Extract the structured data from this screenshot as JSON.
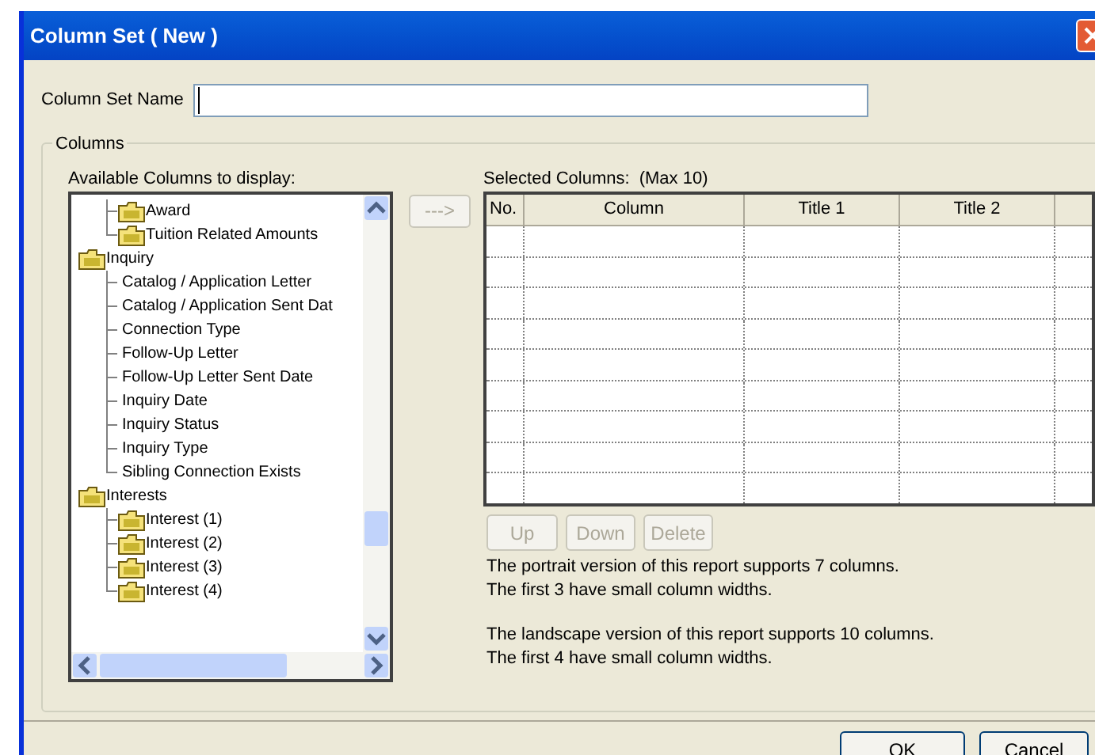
{
  "window": {
    "title": "Column Set ( New )"
  },
  "name_field": {
    "label": "Column Set Name"
  },
  "group": {
    "label": "Columns"
  },
  "available": {
    "label": "Available Columns to display:",
    "items": [
      {
        "children": [
          {
            "kind": "folder",
            "label": "Award"
          },
          {
            "kind": "folder",
            "label": "Tuition Related Amounts"
          }
        ]
      },
      {
        "kind": "folder",
        "label": "Inquiry",
        "children": [
          {
            "kind": "leaf",
            "label": "Catalog / Application Letter"
          },
          {
            "kind": "leaf",
            "label": "Catalog / Application Sent Dat"
          },
          {
            "kind": "leaf",
            "label": "Connection Type"
          },
          {
            "kind": "leaf",
            "label": "Follow-Up Letter"
          },
          {
            "kind": "leaf",
            "label": "Follow-Up Letter Sent Date"
          },
          {
            "kind": "leaf",
            "label": "Inquiry Date"
          },
          {
            "kind": "leaf",
            "label": "Inquiry Status"
          },
          {
            "kind": "leaf",
            "label": "Inquiry Type"
          },
          {
            "kind": "leaf",
            "label": "Sibling Connection Exists"
          }
        ]
      },
      {
        "kind": "folder",
        "label": "Interests",
        "children": [
          {
            "kind": "folder",
            "label": "Interest (1)"
          },
          {
            "kind": "folder",
            "label": "Interest (2)"
          },
          {
            "kind": "folder",
            "label": "Interest (3)"
          },
          {
            "kind": "folder",
            "label": "Interest (4)"
          }
        ]
      }
    ]
  },
  "add_button": {
    "label": "--->",
    "disabled": true
  },
  "selected": {
    "label": "Selected Columns:",
    "max": "(Max 10)",
    "columns": [
      "No.",
      "Column",
      "Title 1",
      "Title 2"
    ]
  },
  "row_buttons": [
    {
      "label": "Up",
      "disabled": true
    },
    {
      "label": "Down",
      "disabled": true
    },
    {
      "label": "Delete",
      "disabled": true
    }
  ],
  "notes": [
    "The portrait version of this report supports 7 columns.",
    "The first 3 have small column widths.",
    "The landscape version of this report supports 10 columns.",
    "The first 4 have small column widths."
  ],
  "buttons": [
    {
      "label": "OK"
    },
    {
      "label": "Cancel"
    }
  ]
}
